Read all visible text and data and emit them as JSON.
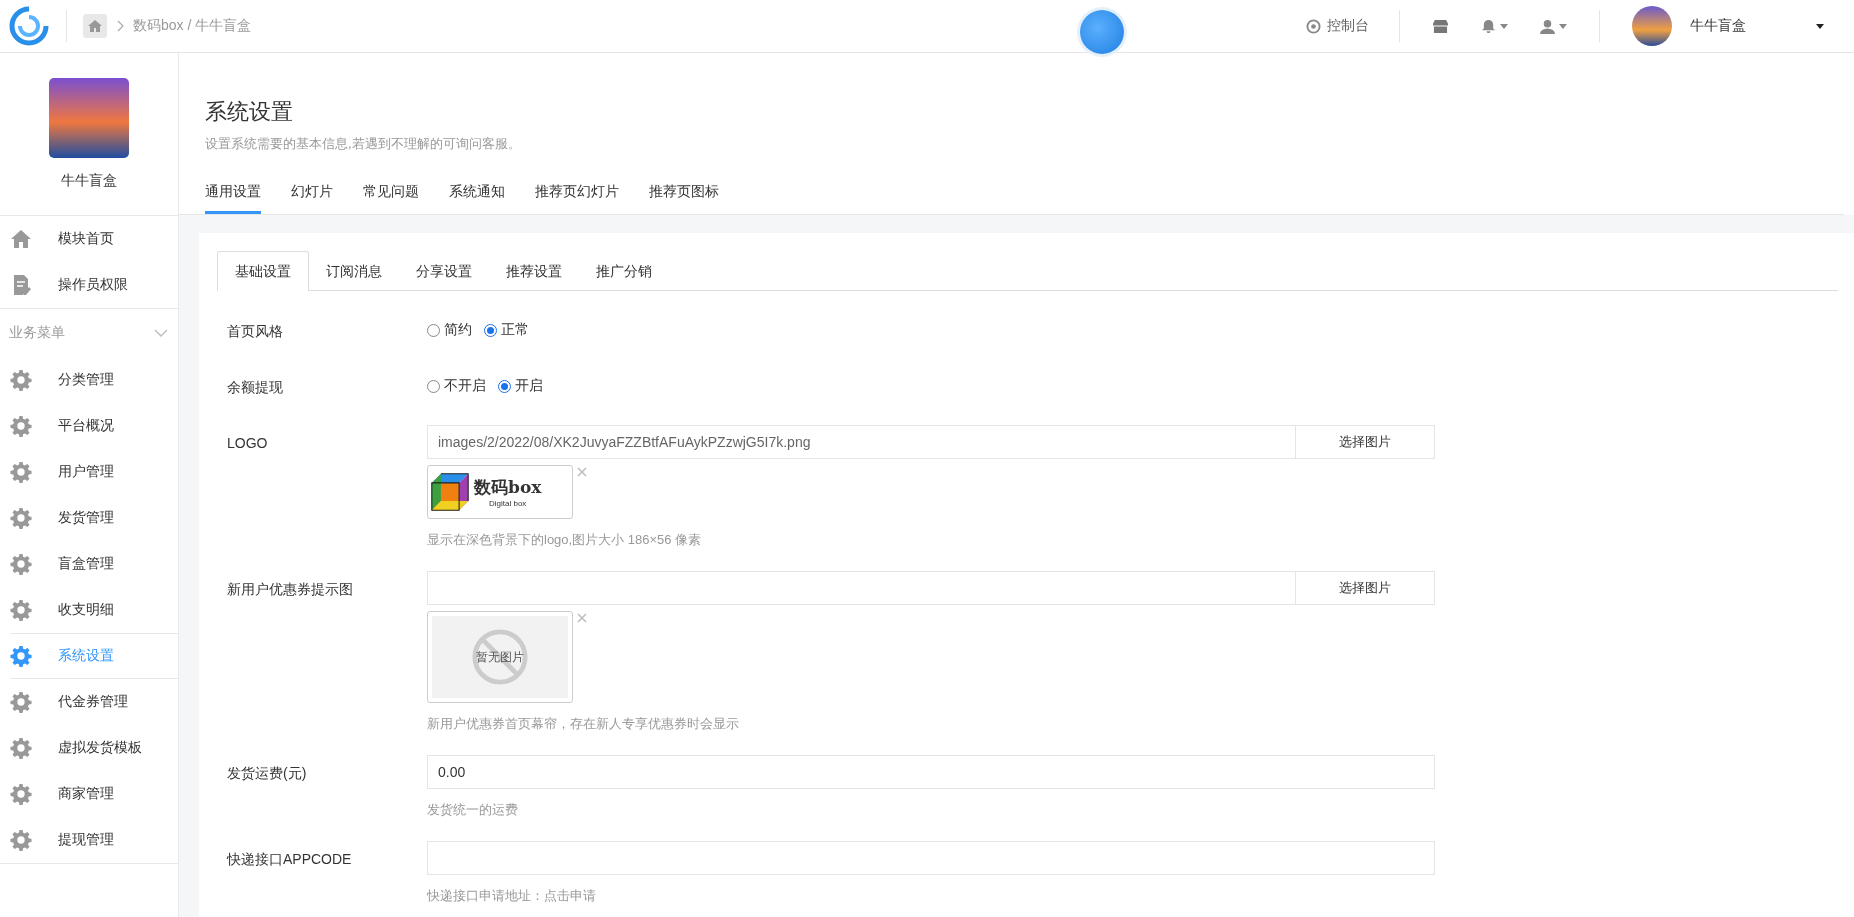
{
  "topbar": {
    "breadcrumb": "数码box / 牛牛盲盒",
    "console": "控制台",
    "username": "牛牛盲盒"
  },
  "sidebar": {
    "profile_name": "牛牛盲盒",
    "items": [
      {
        "label": "模块首页",
        "kind": "home",
        "selected": false
      },
      {
        "label": "操作员权限",
        "kind": "doc",
        "selected": false
      }
    ],
    "section": {
      "title": "业务菜单",
      "expanded": true,
      "items": [
        {
          "label": "分类管理",
          "selected": false
        },
        {
          "label": "平台概况",
          "selected": false
        },
        {
          "label": "用户管理",
          "selected": false
        },
        {
          "label": "发货管理",
          "selected": false
        },
        {
          "label": "盲盒管理",
          "selected": false
        },
        {
          "label": "收支明细",
          "selected": false
        },
        {
          "label": "系统设置",
          "selected": true
        },
        {
          "label": "代金券管理",
          "selected": false
        },
        {
          "label": "虚拟发货模板",
          "selected": false
        },
        {
          "label": "商家管理",
          "selected": false
        },
        {
          "label": "提现管理",
          "selected": false
        }
      ]
    }
  },
  "page": {
    "title": "系统设置",
    "subtitle": "设置系统需要的基本信息,若遇到不理解的可询问客服。"
  },
  "tabs": [
    {
      "label": "通用设置",
      "selected": true
    },
    {
      "label": "幻灯片",
      "selected": false
    },
    {
      "label": "常见问题",
      "selected": false
    },
    {
      "label": "系统通知",
      "selected": false
    },
    {
      "label": "推荐页幻灯片",
      "selected": false
    },
    {
      "label": "推荐页图标",
      "selected": false
    }
  ],
  "subtabs": [
    {
      "label": "基础设置",
      "selected": true
    },
    {
      "label": "订阅消息",
      "selected": false
    },
    {
      "label": "分享设置",
      "selected": false
    },
    {
      "label": "推荐设置",
      "selected": false
    },
    {
      "label": "推广分销",
      "selected": false
    }
  ],
  "form": [
    {
      "kind": "radio",
      "label": "首页风格",
      "options": [
        {
          "label": "简约",
          "selected": false
        },
        {
          "label": "正常",
          "selected": true
        }
      ]
    },
    {
      "kind": "radio",
      "label": "余额提现",
      "options": [
        {
          "label": "不开启",
          "selected": false
        },
        {
          "label": "开启",
          "selected": true
        }
      ]
    },
    {
      "kind": "image",
      "label": "LOGO",
      "value": "images/2/2022/08/XK2JuvyaFZZBtfAFuAykPZzwjG5I7k.png",
      "button": "选择图片",
      "preview": {
        "kind": "logo",
        "text": "数码box",
        "subtext": "Digital box"
      },
      "hint": "显示在深色背景下的logo,图片大小 186×56 像素"
    },
    {
      "kind": "image",
      "label": "新用户优惠券提示图",
      "button": "选择图片",
      "preview": {
        "kind": "empty",
        "text": "暂无图片"
      },
      "hint": "新用户优惠券首页幕帘，存在新人专享优惠券时会显示"
    },
    {
      "kind": "text",
      "label": "发货运费(元)",
      "value": "0.00",
      "hint": "发货统一的运费"
    },
    {
      "kind": "text",
      "label": "快递接口APPCODE",
      "hint": "快递接口申请地址：点击申请"
    }
  ]
}
